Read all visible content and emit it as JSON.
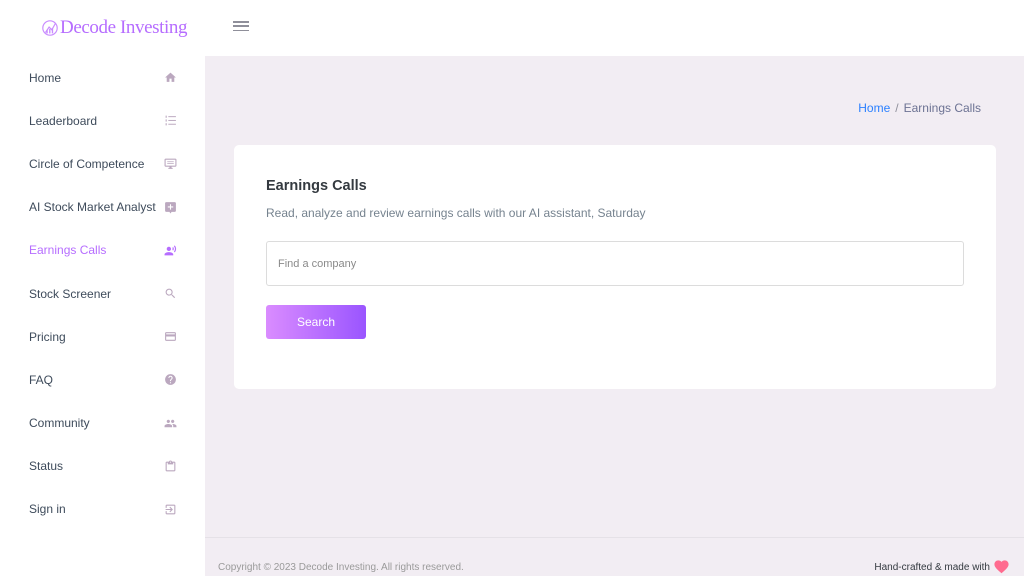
{
  "brand": {
    "name": "Decode Investing",
    "color": "#b66dff"
  },
  "topbar": {
    "menu_icon": "hamburger-icon"
  },
  "sidebar": {
    "items": [
      {
        "label": "Home",
        "icon": "home-icon",
        "active": false
      },
      {
        "label": "Leaderboard",
        "icon": "list-icon",
        "active": false
      },
      {
        "label": "Circle of Competence",
        "icon": "monitor-icon",
        "active": false
      },
      {
        "label": "AI Stock Market Analyst",
        "icon": "plus-box-icon",
        "active": false
      },
      {
        "label": "Earnings Calls",
        "icon": "voice-user-icon",
        "active": true
      },
      {
        "label": "Stock Screener",
        "icon": "search-icon",
        "active": false
      },
      {
        "label": "Pricing",
        "icon": "credit-card-icon",
        "active": false
      },
      {
        "label": "FAQ",
        "icon": "help-circle-icon",
        "active": false
      },
      {
        "label": "Community",
        "icon": "people-icon",
        "active": false
      },
      {
        "label": "Status",
        "icon": "clipboard-icon",
        "active": false
      },
      {
        "label": "Sign in",
        "icon": "sign-in-icon",
        "active": false
      }
    ]
  },
  "breadcrumb": {
    "home": "Home",
    "separator": "/",
    "current": "Earnings Calls"
  },
  "card": {
    "title": "Earnings Calls",
    "description": "Read, analyze and review earnings calls with our AI assistant, Saturday",
    "search_placeholder": "Find a company",
    "search_value": "",
    "search_button": "Search"
  },
  "footer": {
    "copyright": "Copyright © 2023 Decode Investing. All rights reserved.",
    "handcrafted": "Hand-crafted & made with",
    "heart_color": "#ff6b8f"
  },
  "colors": {
    "accent": "#b66dff",
    "gradient_start": "#da8cff",
    "gradient_end": "#9a55ff",
    "link": "#2b80ff",
    "background": "#f2edf3"
  }
}
